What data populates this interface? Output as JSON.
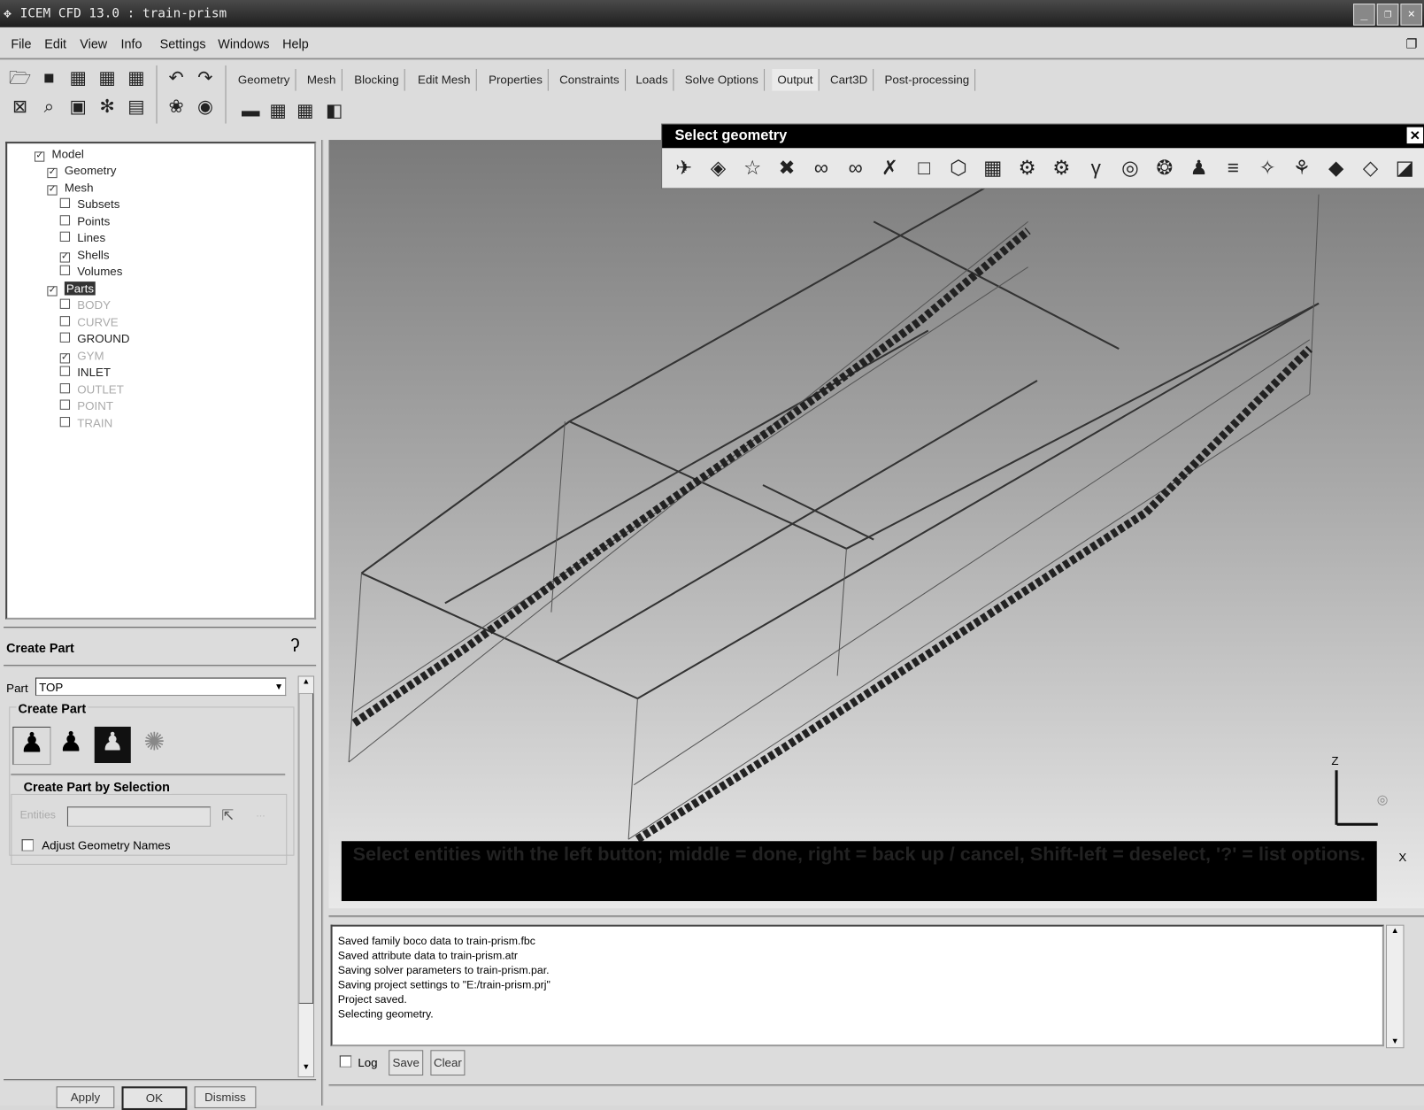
{
  "window": {
    "title": "ICEM CFD 13.0 : train-prism"
  },
  "menu": [
    "File",
    "Edit",
    "View",
    "Info",
    "Settings",
    "Windows",
    "Help"
  ],
  "tabs": [
    "Geometry",
    "Mesh",
    "Blocking",
    "Edit Mesh",
    "Properties",
    "Constraints",
    "Loads",
    "Solve Options",
    "Output",
    "Cart3D",
    "Post-processing"
  ],
  "active_tab": "Output",
  "tree": {
    "root": "Model",
    "items": [
      {
        "label": "Geometry",
        "checked": true,
        "enabled": true
      },
      {
        "label": "Mesh",
        "checked": true,
        "enabled": true
      },
      {
        "label": "Subsets",
        "checked": false,
        "enabled": true
      },
      {
        "label": "Points",
        "checked": false,
        "enabled": true
      },
      {
        "label": "Lines",
        "checked": false,
        "enabled": true
      },
      {
        "label": "Shells",
        "checked": true,
        "enabled": true
      },
      {
        "label": "Volumes",
        "checked": false,
        "enabled": true
      },
      {
        "label": "Parts",
        "checked": true,
        "enabled": true,
        "selected": true
      },
      {
        "label": "BODY",
        "checked": false,
        "enabled": false
      },
      {
        "label": "CURVE",
        "checked": false,
        "enabled": false
      },
      {
        "label": "GROUND",
        "checked": false,
        "enabled": true
      },
      {
        "label": "GYM",
        "checked": true,
        "enabled": false
      },
      {
        "label": "INLET",
        "checked": false,
        "enabled": true
      },
      {
        "label": "OUTLET",
        "checked": false,
        "enabled": false
      },
      {
        "label": "POINT",
        "checked": false,
        "enabled": false
      },
      {
        "label": "TRAIN",
        "checked": false,
        "enabled": false
      }
    ]
  },
  "create_part": {
    "title": "Create Part",
    "part_label": "Part",
    "part_value": "TOP",
    "group_label": "Create Part",
    "by_selection_label": "Create Part by Selection",
    "entities_label": "Entities",
    "entities_value": "",
    "adjust_names_label": "Adjust Geometry Names",
    "adjust_names_checked": false,
    "apply": "Apply",
    "ok": "OK",
    "dismiss": "Dismiss"
  },
  "select_geometry": {
    "title": "Select geometry"
  },
  "viewport": {
    "prompt": "Select entities with the left button; middle = done, right = back up / cancel, Shift-left = deselect, '?' = list options.",
    "axis_z": "Z",
    "axis_x": "X"
  },
  "console": {
    "lines": [
      "Saved family boco data to train-prism.fbc",
      "Saved attribute data to train-prism.atr",
      "Saving solver parameters to train-prism.par.",
      "Saving project settings to \"E:/train-prism.prj\"",
      "Project saved.",
      "Selecting geometry."
    ],
    "log_label": "Log",
    "log_checked": false,
    "save": "Save",
    "clear": "Clear"
  }
}
